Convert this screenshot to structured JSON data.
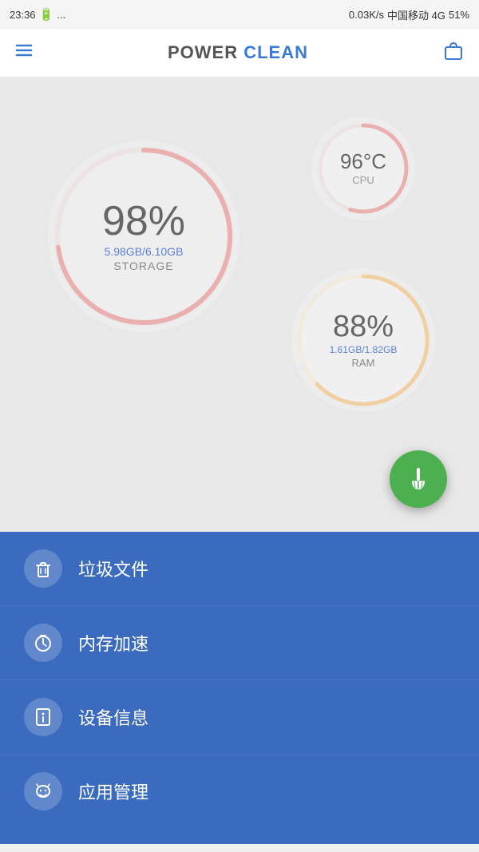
{
  "statusBar": {
    "time": "23:36",
    "network": "0.03K/s",
    "carrier": "中国移动 4G",
    "battery": "51%"
  },
  "header": {
    "menuIcon": "hamburger-menu",
    "title": "POWER CLEAN",
    "titlePower": "POWER",
    "titleClean": "CLEAN",
    "bagIcon": "shopping-bag"
  },
  "dashboard": {
    "storage": {
      "percent": "98%",
      "used": "5.98GB",
      "total": "6.10GB",
      "label": "STORAGE",
      "percentValue": 98,
      "color": "#e05252"
    },
    "cpu": {
      "temp": "96°C",
      "label": "CPU",
      "percentValue": 80,
      "color": "#e05252"
    },
    "ram": {
      "percent": "88%",
      "used": "1.61GB",
      "total": "1.82GB",
      "label": "RAM",
      "percentValue": 88,
      "color": "#f0a030"
    }
  },
  "fab": {
    "icon": "broom",
    "label": "Clean"
  },
  "navItems": [
    {
      "id": "junk",
      "icon": "trash",
      "label": "垃圾文件"
    },
    {
      "id": "memory",
      "icon": "timer",
      "label": "内存加速"
    },
    {
      "id": "device",
      "icon": "info",
      "label": "设备信息"
    },
    {
      "id": "apps",
      "icon": "android",
      "label": "应用管理"
    }
  ]
}
